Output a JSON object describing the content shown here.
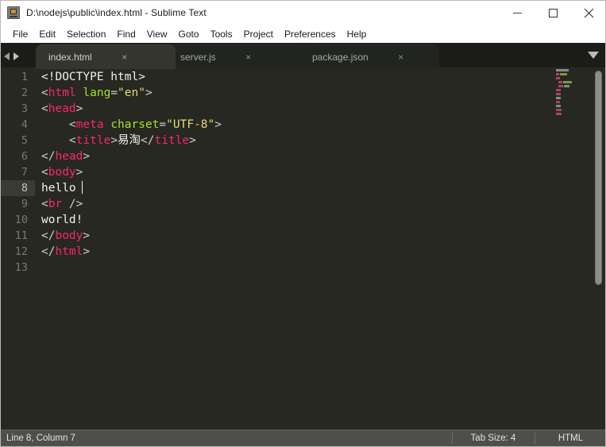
{
  "window": {
    "title": "D:\\nodejs\\public\\index.html - Sublime Text",
    "icon": "sublime-text-icon",
    "minimize_label": "–",
    "maximize_label": "□",
    "close_label": "✕"
  },
  "menubar": {
    "items": [
      {
        "label": "File"
      },
      {
        "label": "Edit"
      },
      {
        "label": "Selection"
      },
      {
        "label": "Find"
      },
      {
        "label": "View"
      },
      {
        "label": "Goto"
      },
      {
        "label": "Tools"
      },
      {
        "label": "Project"
      },
      {
        "label": "Preferences"
      },
      {
        "label": "Help"
      }
    ]
  },
  "tabbar": {
    "nav_prev": "prev-tab-arrow",
    "nav_next": "next-tab-arrow",
    "dropdown": "tab-list-dropdown",
    "close_glyph": "×",
    "tabs": [
      {
        "label": "index.html",
        "active": true,
        "closable": true
      },
      {
        "label": "server.js",
        "active": false,
        "closable": true
      },
      {
        "label": "package.json",
        "active": false,
        "closable": true
      }
    ]
  },
  "editor": {
    "active_line": 8,
    "cursor_line": 8,
    "cursor_column": 7,
    "lines": [
      {
        "number": "1",
        "text": "<!DOCTYPE html>",
        "tokens": [
          {
            "t": "<!DOCTYPE html>",
            "c": "t-doct"
          }
        ]
      },
      {
        "number": "2",
        "text": "<html lang=\"en\">",
        "tokens": [
          {
            "t": "<",
            "c": "t-punc"
          },
          {
            "t": "html",
            "c": "t-tag"
          },
          {
            "t": " ",
            "c": "t-punc"
          },
          {
            "t": "lang",
            "c": "t-attr"
          },
          {
            "t": "=",
            "c": "t-punc"
          },
          {
            "t": "\"en\"",
            "c": "t-str"
          },
          {
            "t": ">",
            "c": "t-punc"
          }
        ]
      },
      {
        "number": "3",
        "text": "<head>",
        "tokens": [
          {
            "t": "<",
            "c": "t-punc"
          },
          {
            "t": "head",
            "c": "t-tag"
          },
          {
            "t": ">",
            "c": "t-punc"
          }
        ]
      },
      {
        "number": "4",
        "text": "    <meta charset=\"UTF-8\">",
        "tokens": [
          {
            "t": "    ",
            "c": "t-punc"
          },
          {
            "t": "<",
            "c": "t-punc"
          },
          {
            "t": "meta",
            "c": "t-tag"
          },
          {
            "t": " ",
            "c": "t-punc"
          },
          {
            "t": "charset",
            "c": "t-attr"
          },
          {
            "t": "=",
            "c": "t-punc"
          },
          {
            "t": "\"UTF-8\"",
            "c": "t-str"
          },
          {
            "t": ">",
            "c": "t-punc"
          }
        ]
      },
      {
        "number": "5",
        "text": "    <title>易淘</title>",
        "tokens": [
          {
            "t": "    ",
            "c": "t-punc"
          },
          {
            "t": "<",
            "c": "t-punc"
          },
          {
            "t": "title",
            "c": "t-tag"
          },
          {
            "t": ">",
            "c": "t-punc"
          },
          {
            "t": "易淘",
            "c": "t-text"
          },
          {
            "t": "</",
            "c": "t-punc"
          },
          {
            "t": "title",
            "c": "t-tag"
          },
          {
            "t": ">",
            "c": "t-punc"
          }
        ]
      },
      {
        "number": "6",
        "text": "</head>",
        "tokens": [
          {
            "t": "</",
            "c": "t-punc"
          },
          {
            "t": "head",
            "c": "t-tag"
          },
          {
            "t": ">",
            "c": "t-punc"
          }
        ]
      },
      {
        "number": "7",
        "text": "<body>",
        "tokens": [
          {
            "t": "<",
            "c": "t-punc"
          },
          {
            "t": "body",
            "c": "t-tag"
          },
          {
            "t": ">",
            "c": "t-punc"
          }
        ]
      },
      {
        "number": "8",
        "text": "hello ",
        "active": true,
        "cursor_after": true,
        "tokens": [
          {
            "t": "hello ",
            "c": "t-text"
          }
        ]
      },
      {
        "number": "9",
        "text": "<br />",
        "tokens": [
          {
            "t": "<",
            "c": "t-punc"
          },
          {
            "t": "br",
            "c": "t-tag"
          },
          {
            "t": " />",
            "c": "t-punc"
          }
        ]
      },
      {
        "number": "10",
        "text": "world!",
        "tokens": [
          {
            "t": "world!",
            "c": "t-text"
          }
        ]
      },
      {
        "number": "11",
        "text": "</body>",
        "tokens": [
          {
            "t": "</",
            "c": "t-punc"
          },
          {
            "t": "body",
            "c": "t-tag"
          },
          {
            "t": ">",
            "c": "t-punc"
          }
        ]
      },
      {
        "number": "12",
        "text": "</html>",
        "tokens": [
          {
            "t": "</",
            "c": "t-punc"
          },
          {
            "t": "html",
            "c": "t-tag"
          },
          {
            "t": ">",
            "c": "t-punc"
          }
        ]
      },
      {
        "number": "13",
        "text": "",
        "tokens": []
      }
    ]
  },
  "minimap": {
    "rows": [
      {
        "segs": [
          {
            "x": 0,
            "w": 16,
            "color": "#8a8b84"
          }
        ]
      },
      {
        "segs": [
          {
            "x": 0,
            "w": 4,
            "color": "#a8446a"
          },
          {
            "x": 5,
            "w": 9,
            "color": "#7d9a3c"
          }
        ]
      },
      {
        "segs": [
          {
            "x": 0,
            "w": 5,
            "color": "#a8446a"
          }
        ]
      },
      {
        "segs": [
          {
            "x": 3,
            "w": 5,
            "color": "#a8446a"
          },
          {
            "x": 9,
            "w": 11,
            "color": "#7d9a3c"
          }
        ]
      },
      {
        "segs": [
          {
            "x": 3,
            "w": 6,
            "color": "#a8446a"
          },
          {
            "x": 10,
            "w": 7,
            "color": "#8a8b84"
          }
        ]
      },
      {
        "segs": [
          {
            "x": 0,
            "w": 6,
            "color": "#a8446a"
          }
        ]
      },
      {
        "segs": [
          {
            "x": 0,
            "w": 6,
            "color": "#a8446a"
          }
        ]
      },
      {
        "segs": [
          {
            "x": 0,
            "w": 6,
            "color": "#8a8b84"
          }
        ]
      },
      {
        "segs": [
          {
            "x": 0,
            "w": 5,
            "color": "#a8446a"
          }
        ]
      },
      {
        "segs": [
          {
            "x": 0,
            "w": 6,
            "color": "#8a8b84"
          }
        ]
      },
      {
        "segs": [
          {
            "x": 0,
            "w": 7,
            "color": "#a8446a"
          }
        ]
      },
      {
        "segs": [
          {
            "x": 0,
            "w": 7,
            "color": "#a8446a"
          }
        ]
      }
    ]
  },
  "scrollbar": {
    "name": "vertical-scrollbar"
  },
  "statusbar": {
    "position": "Line 8, Column 7",
    "tab_size": "Tab Size: 4",
    "syntax": "HTML"
  },
  "colors": {
    "editor_bg": "#262821",
    "tag": "#f92672",
    "attribute": "#a6e22e",
    "string": "#e6db74",
    "text": "#f1f2e8",
    "punctuation": "#cfd0c4",
    "statusbar_bg": "#4e4f4a",
    "active_line": "#3a3b33"
  }
}
